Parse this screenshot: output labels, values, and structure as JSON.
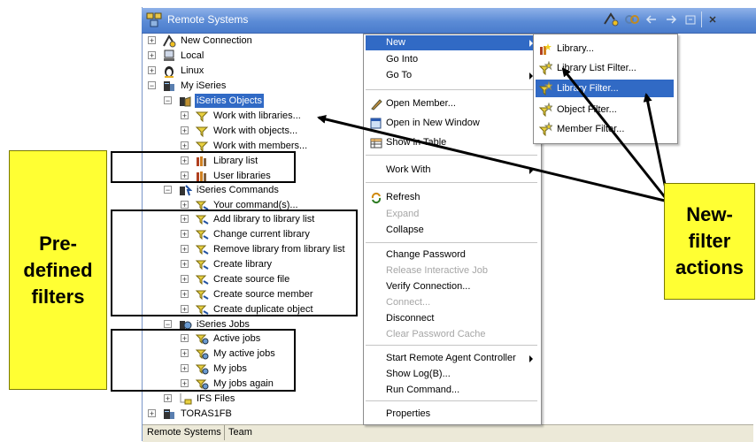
{
  "window": {
    "title": "Remote Systems",
    "toolbar_icons": [
      "new-connection-icon",
      "link-icon",
      "back-arrow-icon",
      "forward-arrow-icon",
      "home-icon",
      "menu-icon"
    ]
  },
  "tree": {
    "rows": [
      {
        "label": "New Connection",
        "icon": "new-connection-icon"
      },
      {
        "label": "Local",
        "icon": "computer-icon"
      },
      {
        "label": "Linux",
        "icon": "linux-icon"
      },
      {
        "label": "My iSeries",
        "icon": "iseries-icon"
      },
      {
        "label": "iSeries Objects",
        "icon": "objects-icon"
      },
      {
        "label": "Work with libraries...",
        "icon": "filter-icon"
      },
      {
        "label": "Work with objects...",
        "icon": "filter-icon"
      },
      {
        "label": "Work with members...",
        "icon": "filter-icon"
      },
      {
        "label": "Library list",
        "icon": "library-icon"
      },
      {
        "label": "User libraries",
        "icon": "library-icon"
      },
      {
        "label": "iSeries Commands",
        "icon": "commands-icon"
      },
      {
        "label": "Your command(s)...",
        "icon": "command-filter-icon"
      },
      {
        "label": "Add library to library list",
        "icon": "command-filter-icon"
      },
      {
        "label": "Change current library",
        "icon": "command-filter-icon"
      },
      {
        "label": "Remove library from library list",
        "icon": "command-filter-icon"
      },
      {
        "label": "Create library",
        "icon": "command-filter-icon"
      },
      {
        "label": "Create source file",
        "icon": "command-filter-icon"
      },
      {
        "label": "Create source member",
        "icon": "command-filter-icon"
      },
      {
        "label": "Create duplicate object",
        "icon": "command-filter-icon"
      },
      {
        "label": "iSeries Jobs",
        "icon": "jobs-icon"
      },
      {
        "label": "Active jobs",
        "icon": "job-filter-icon"
      },
      {
        "label": "My active jobs",
        "icon": "job-filter-icon"
      },
      {
        "label": "My jobs",
        "icon": "job-filter-icon"
      },
      {
        "label": "My jobs again",
        "icon": "job-filter-icon"
      },
      {
        "label": "IFS Files",
        "icon": "ifs-icon"
      },
      {
        "label": "TORAS1FB",
        "icon": "iseries-icon"
      }
    ]
  },
  "context_menu": {
    "items": [
      "New",
      "Go Into",
      "Go To",
      "Open Member...",
      "Open in New Window",
      "Show in Table",
      "Work With",
      "Refresh",
      "Expand",
      "Collapse",
      "Change Password",
      "Release Interactive Job",
      "Verify Connection...",
      "Connect...",
      "Disconnect",
      "Clear Password Cache",
      "Start Remote Agent Controller",
      "Show Log(B)...",
      "Run Command...",
      "Properties"
    ]
  },
  "submenu": {
    "items": [
      "Library...",
      "Library List Filter...",
      "Library Filter...",
      "Object Filter...",
      "Member Filter..."
    ]
  },
  "status_bar": {
    "tab1": "Remote Systems",
    "tab2": "Team"
  },
  "callouts": {
    "predefined": "Pre-\ndefined\nfilters",
    "new_filter": "New-\nfilter\nactions"
  },
  "colors": {
    "selection": "#316ac5",
    "callout": "#ffff33",
    "titlebar": "#5b8bd6"
  }
}
